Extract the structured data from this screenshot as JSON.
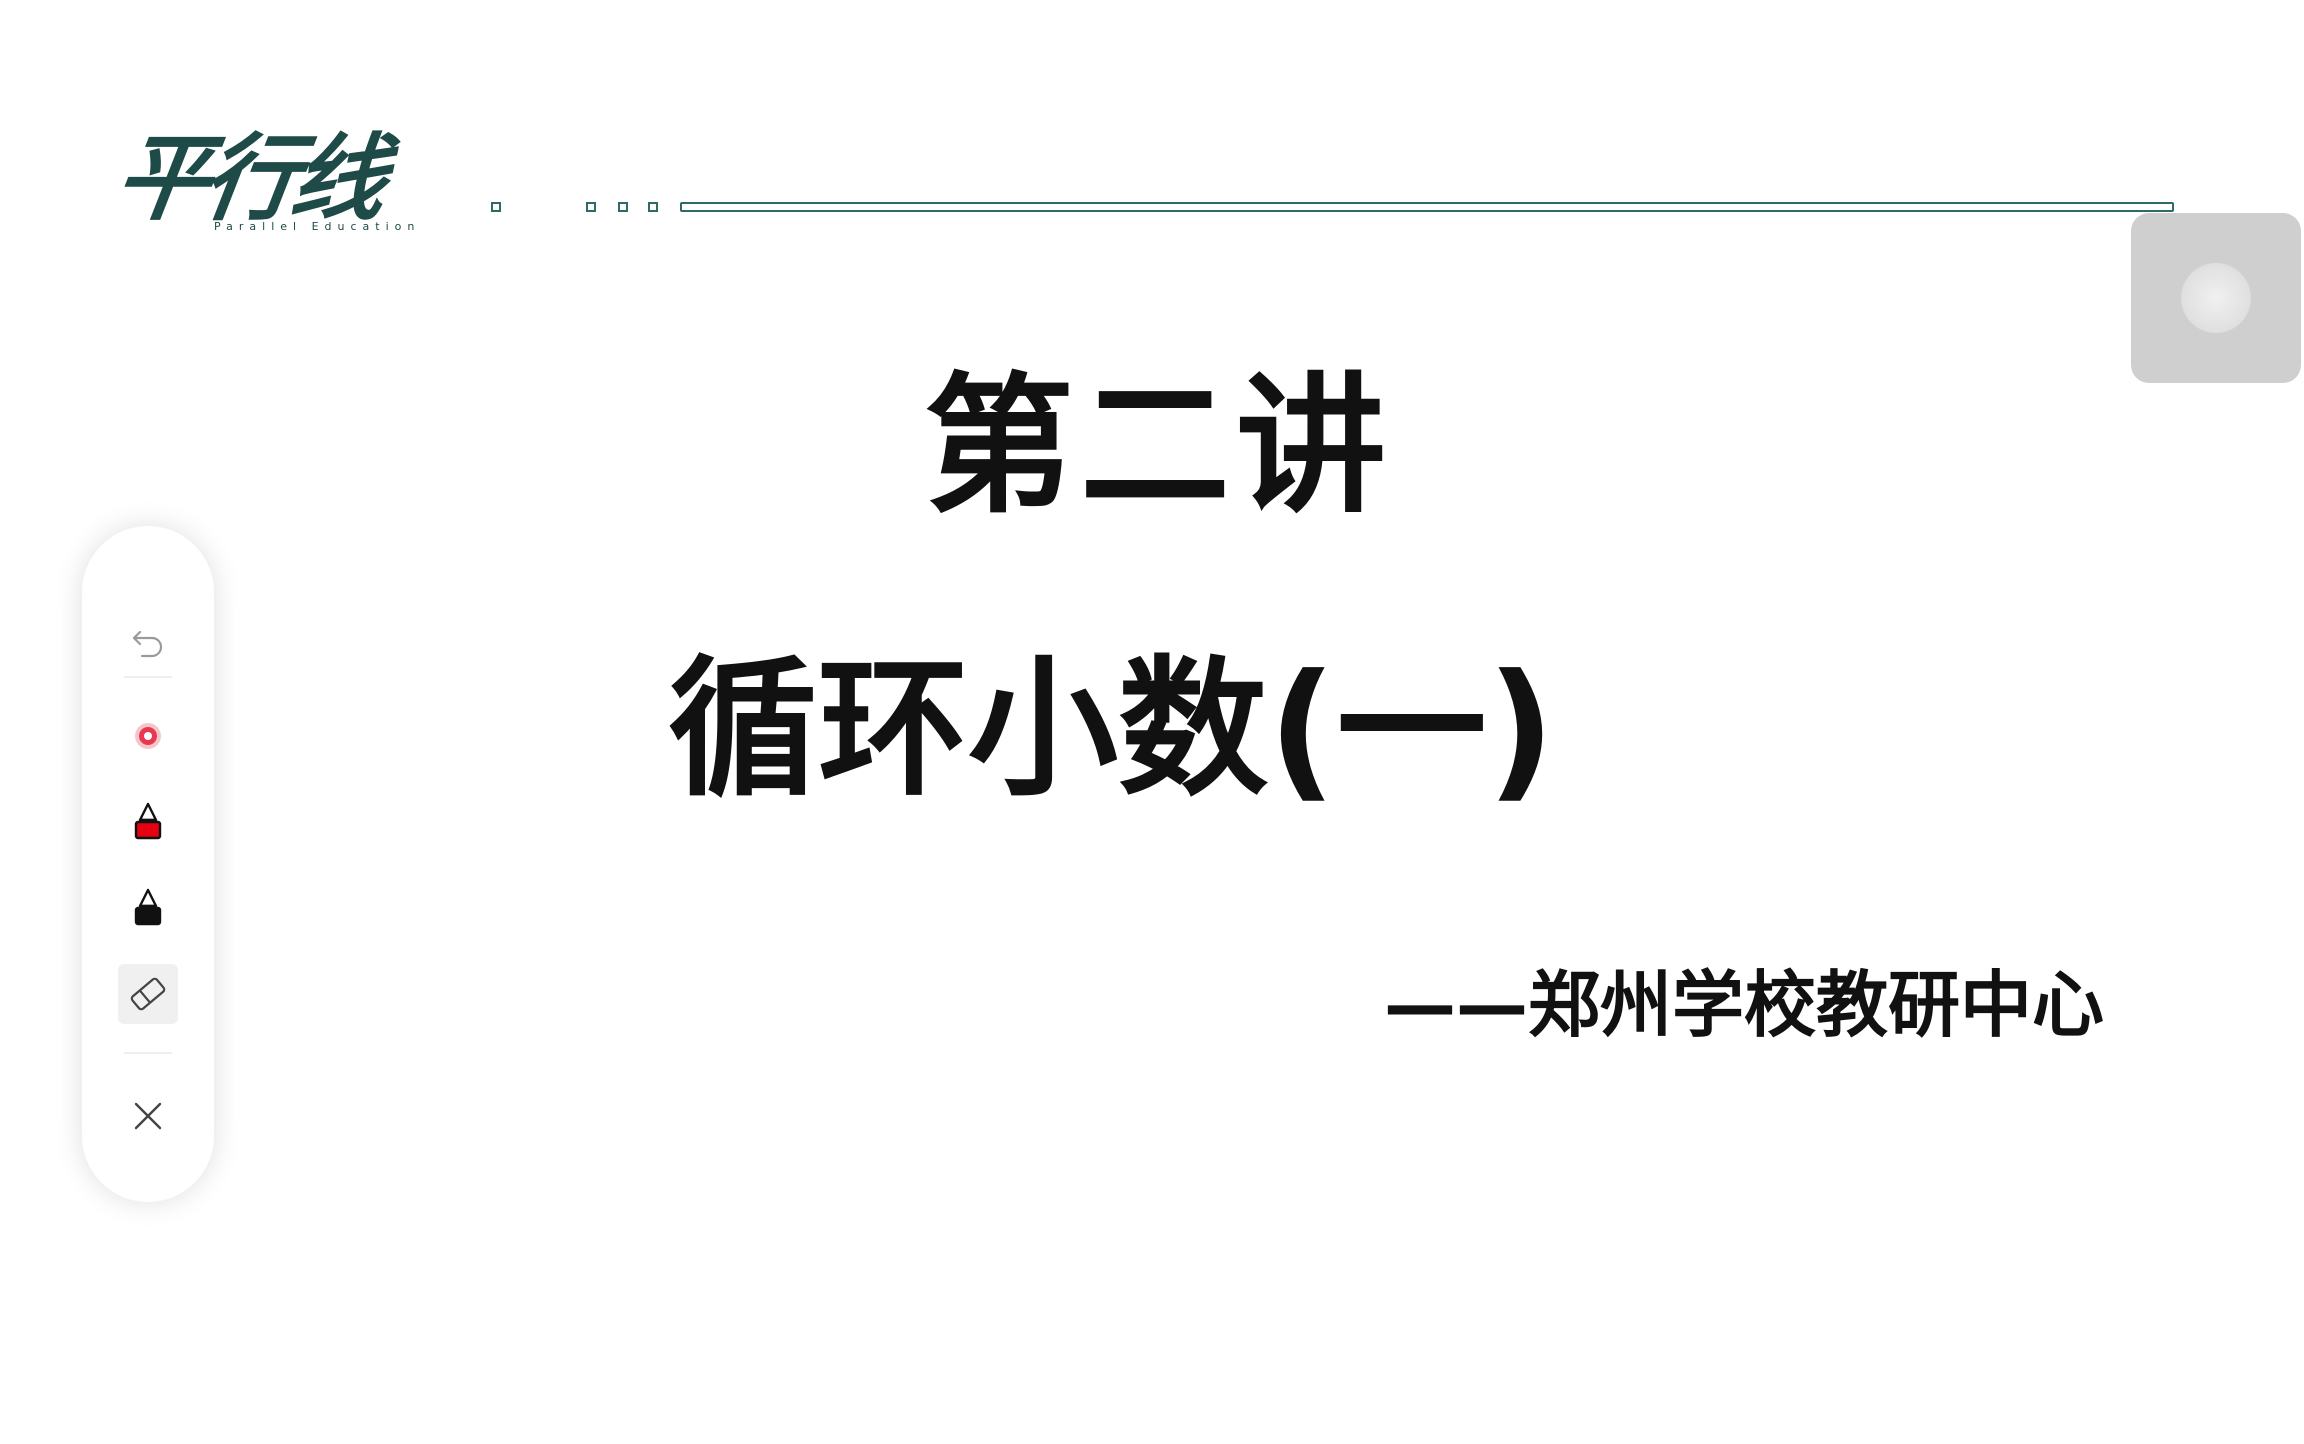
{
  "header": {
    "logo_text": "平行线",
    "logo_subtext": "Parallel Education"
  },
  "slide": {
    "lecture": "第二讲",
    "topic": "循环小数(一)",
    "source": "——郑州学校教研中心"
  },
  "toolbar": {
    "tools": [
      {
        "name": "undo-icon"
      },
      {
        "name": "laser-pointer-icon",
        "color": "#e8384f"
      },
      {
        "name": "red-pen-icon",
        "color": "#e60012"
      },
      {
        "name": "black-pen-icon",
        "color": "#111111"
      },
      {
        "name": "eraser-icon"
      },
      {
        "name": "close-icon"
      }
    ]
  },
  "colors": {
    "brand": "#1e4a47",
    "accent_line": "#2e6b66",
    "text": "#111111"
  }
}
